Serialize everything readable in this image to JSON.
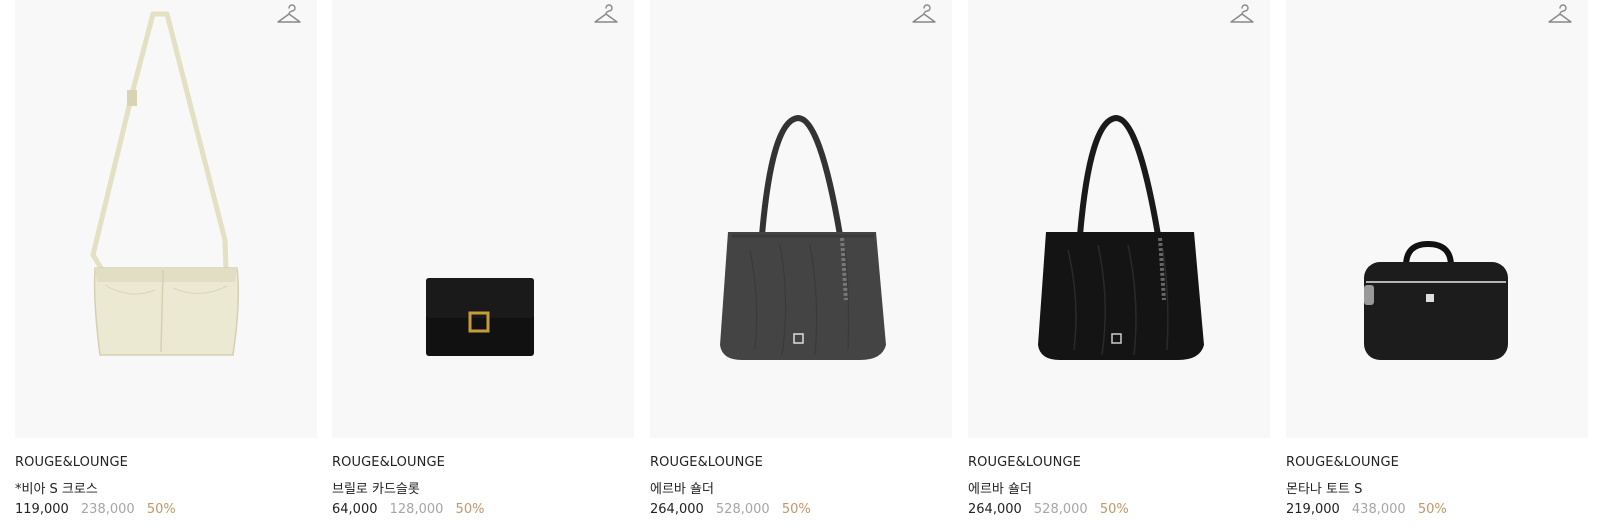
{
  "products": [
    {
      "brand": "ROUGE&LOUNGE",
      "name": "*비아 S 크로스",
      "price": "119,000",
      "original_price": "238,000",
      "discount": "50%",
      "bag_color": "#ece9d2"
    },
    {
      "brand": "ROUGE&LOUNGE",
      "name": "브릴로 카드슬롯",
      "price": "64,000",
      "original_price": "128,000",
      "discount": "50%",
      "bag_color": "#111111"
    },
    {
      "brand": "ROUGE&LOUNGE",
      "name": "에르바 숄더",
      "price": "264,000",
      "original_price": "528,000",
      "discount": "50%",
      "bag_color": "#444444"
    },
    {
      "brand": "ROUGE&LOUNGE",
      "name": "에르바 숄더",
      "price": "264,000",
      "original_price": "528,000",
      "discount": "50%",
      "bag_color": "#141414"
    },
    {
      "brand": "ROUGE&LOUNGE",
      "name": "몬타나 토트 S",
      "price": "219,000",
      "original_price": "438,000",
      "discount": "50%",
      "bag_color": "#1c1c1c"
    }
  ],
  "icons": {
    "wishlist": "hanger-icon"
  },
  "colors": {
    "discount": "#c0976b",
    "original_price": "#a6a6a6",
    "text": "#222222",
    "image_bg": "#f8f8f8"
  }
}
